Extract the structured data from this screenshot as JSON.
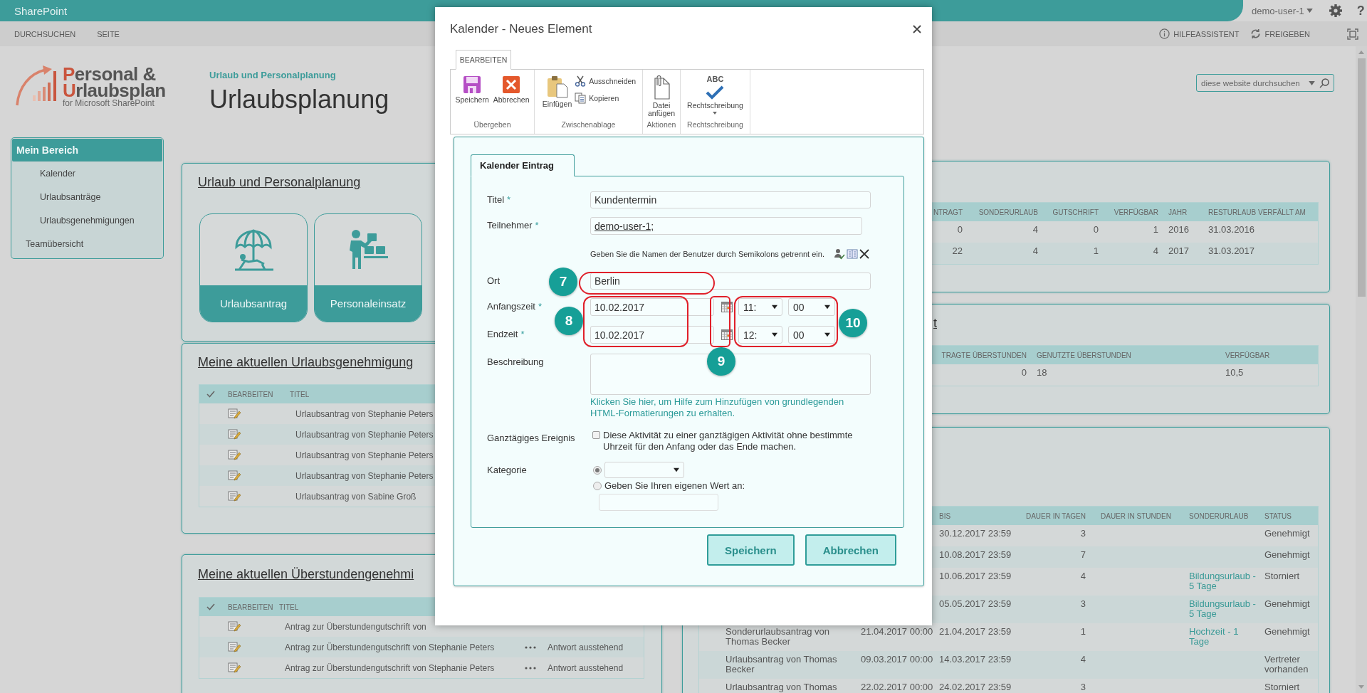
{
  "suite_bar": {
    "brand": "SharePoint",
    "user": "demo-user-1",
    "help": "?"
  },
  "command_bar": {
    "links": [
      "DURCHSUCHEN",
      "SEITE"
    ],
    "actions": [
      {
        "kind": "help",
        "label": "HILFEASSISTENT"
      },
      {
        "kind": "share",
        "label": "FREIGEBEN"
      }
    ]
  },
  "header": {
    "logo": {
      "line1": "Personal &",
      "line2": "Urlaubsplan",
      "tagline": "for Microsoft SharePoint"
    },
    "breadcrumb": "Urlaub und Personalplanung",
    "title": "Urlaubsplanung",
    "search": {
      "placeholder": "diese website durchsuchen"
    }
  },
  "nav": [
    {
      "label": "Mein Bereich",
      "selected": true,
      "children": [
        {
          "label": "Kalender",
          "selected": false
        },
        {
          "label": "Urlaubsanträge",
          "selected": false
        },
        {
          "label": "Urlaubsgenehmigungen",
          "selected": false
        }
      ]
    },
    {
      "label": "Teamübersicht",
      "selected": false
    }
  ],
  "tiles_panel": {
    "title": "Urlaub und Personalplanung",
    "tiles": [
      {
        "label": "Urlaubsantrag"
      },
      {
        "label": "Personaleinsatz"
      }
    ]
  },
  "approvals_panel": {
    "title": "Meine aktuellen Urlaubsgenehmigung",
    "columns": [
      "BEARBEITEN",
      "TITEL"
    ],
    "rows": [
      {
        "title": "Urlaubsantrag von Stephanie Peters"
      },
      {
        "title": "Urlaubsantrag von Stephanie Peters"
      },
      {
        "title": "Urlaubsantrag von Stephanie Peters"
      },
      {
        "title": "Urlaubsantrag von Stephanie Peters"
      },
      {
        "title": "Urlaubsantrag von Sabine Groß"
      }
    ]
  },
  "overtime_panel": {
    "title": "Meine aktuellen Überstundengenehmi",
    "columns": [
      "BEARBEITEN",
      "TITEL"
    ],
    "rows": [
      {
        "title": "Antrag zur Überstundengutschrift von"
      },
      {
        "title": "Antrag zur Überstundengutschrift von Stephanie Peters",
        "status": "Antwort ausstehend"
      },
      {
        "title": "Antrag zur Überstundengutschrift von Stephanie Peters",
        "status": "Antwort ausstehend"
      }
    ]
  },
  "balance_panel": {
    "columns": [
      "NTRAGT",
      "SONDERURLAUB",
      "GUTSCHRIFT",
      "VERFÜGBAR",
      "JAHR",
      "RESTURLAUB VERFÄLLT AM"
    ],
    "rows": [
      [
        "0",
        "4",
        "0",
        "1",
        "2016",
        "31.03.2016"
      ],
      [
        "22",
        "4",
        "1",
        "4",
        "2017",
        "31.03.2017"
      ]
    ]
  },
  "overtime_balance_panel": {
    "title": "t",
    "columns": [
      "TRAGTE ÜBERSTUNDEN",
      "GENUTZTE ÜBERSTUNDEN",
      "VERFÜGBAR"
    ],
    "rows": [
      [
        "0",
        "18",
        "10,5"
      ]
    ]
  },
  "requests_panel": {
    "columns": [
      "BIS",
      "DAUER IN TAGEN",
      "DAUER IN STUNDEN",
      "SONDERURLAUB",
      "STATUS"
    ],
    "rows": [
      {
        "to": "30.12.2017 23:59",
        "days": "3",
        "status": "Genehmigt"
      },
      {
        "to": "10.08.2017 23:59",
        "days": "7",
        "status": "Genehmigt"
      },
      {
        "to": "10.06.2017 23:59",
        "days": "4",
        "special": "Bildungsurlaub - 5 Tage",
        "status": "Storniert"
      },
      {
        "to": "05.05.2017 23:59",
        "days": "3",
        "special": "Bildungsurlaub - 5 Tage",
        "status": "Genehmigt"
      },
      {
        "title": "Sonderurlaubsantrag von Thomas Becker",
        "from": "21.04.2017 00:00",
        "to": "21.04.2017 23:59",
        "days": "1",
        "special": "Hochzeit - 1 Tage",
        "status": "Genehmigt"
      },
      {
        "title": "Urlaubsantrag von Thomas Becker",
        "from": "09.03.2017 00:00",
        "to": "14.03.2017 23:59",
        "days": "4",
        "status": "Vertreter vorhanden"
      },
      {
        "title": "Urlaubsantrag von Thomas",
        "from": "22.02.2017 00:00",
        "to": "24.02.2017 23:59",
        "days": "3",
        "status": "Storniert"
      }
    ]
  },
  "dialog": {
    "title": "Kalender - Neues Element",
    "ribbon": {
      "tab": "BEARBEITEN",
      "groups": [
        {
          "label": "Übergeben",
          "commands": [
            {
              "kind": "save",
              "label": "Speichern"
            },
            {
              "kind": "cancel",
              "label": "Abbrechen"
            }
          ]
        },
        {
          "label": "Zwischenablage",
          "commands": [
            {
              "kind": "paste",
              "label": "Einfügen"
            },
            {
              "kind": "cut",
              "label": "Ausschneiden"
            },
            {
              "kind": "copy",
              "label": "Kopieren"
            }
          ]
        },
        {
          "label": "Aktionen",
          "commands": [
            {
              "kind": "attach",
              "label": "Datei anfügen"
            }
          ]
        },
        {
          "label": "Rechtschreibung",
          "commands": [
            {
              "kind": "spelling",
              "label": "Rechtschreibung",
              "icon_text": "ABC"
            }
          ]
        }
      ]
    },
    "form": {
      "tab": "Kalender Eintrag",
      "fields": [
        {
          "kind": "text",
          "label": "Titel",
          "required_mark": "*",
          "value": "Kundentermin"
        },
        {
          "kind": "people",
          "label": "Teilnehmer",
          "required_mark": "*",
          "value": "demo-user-1;",
          "hint": "Geben Sie die Namen der Benutzer durch Semikolons getrennt ein."
        },
        {
          "kind": "text",
          "label": "Ort",
          "value": "Berlin"
        },
        {
          "kind": "datetime",
          "label": "Anfangszeit",
          "required_mark": "*",
          "date": "10.02.2017",
          "hour": "11:",
          "minute": "00"
        },
        {
          "kind": "datetime",
          "label": "Endzeit",
          "required_mark": "*",
          "date": "10.02.2017",
          "hour": "12:",
          "minute": "00"
        },
        {
          "kind": "richtext",
          "label": "Beschreibung",
          "help": "Klicken Sie hier, um Hilfe zum Hinzufügen von grundlegenden HTML-Formatierungen zu erhalten."
        },
        {
          "kind": "checkbox",
          "label": "Ganztägiges Ereignis",
          "checked": false,
          "text": "Diese Aktivität zu einer ganztägigen Aktivität ohne bestimmte Uhrzeit für den Anfang oder das Ende machen."
        },
        {
          "kind": "choice",
          "label": "Kategorie",
          "options": [
            {
              "kind": "dropdown",
              "selected": true
            },
            {
              "kind": "fillin",
              "label": "Geben Sie Ihren eigenen Wert an:",
              "selected": false
            }
          ]
        }
      ]
    },
    "buttons": [
      "Speichern",
      "Abbrechen"
    ],
    "callouts": [
      {
        "number": "7"
      },
      {
        "number": "8"
      },
      {
        "number": "9"
      },
      {
        "number": "10"
      }
    ]
  }
}
